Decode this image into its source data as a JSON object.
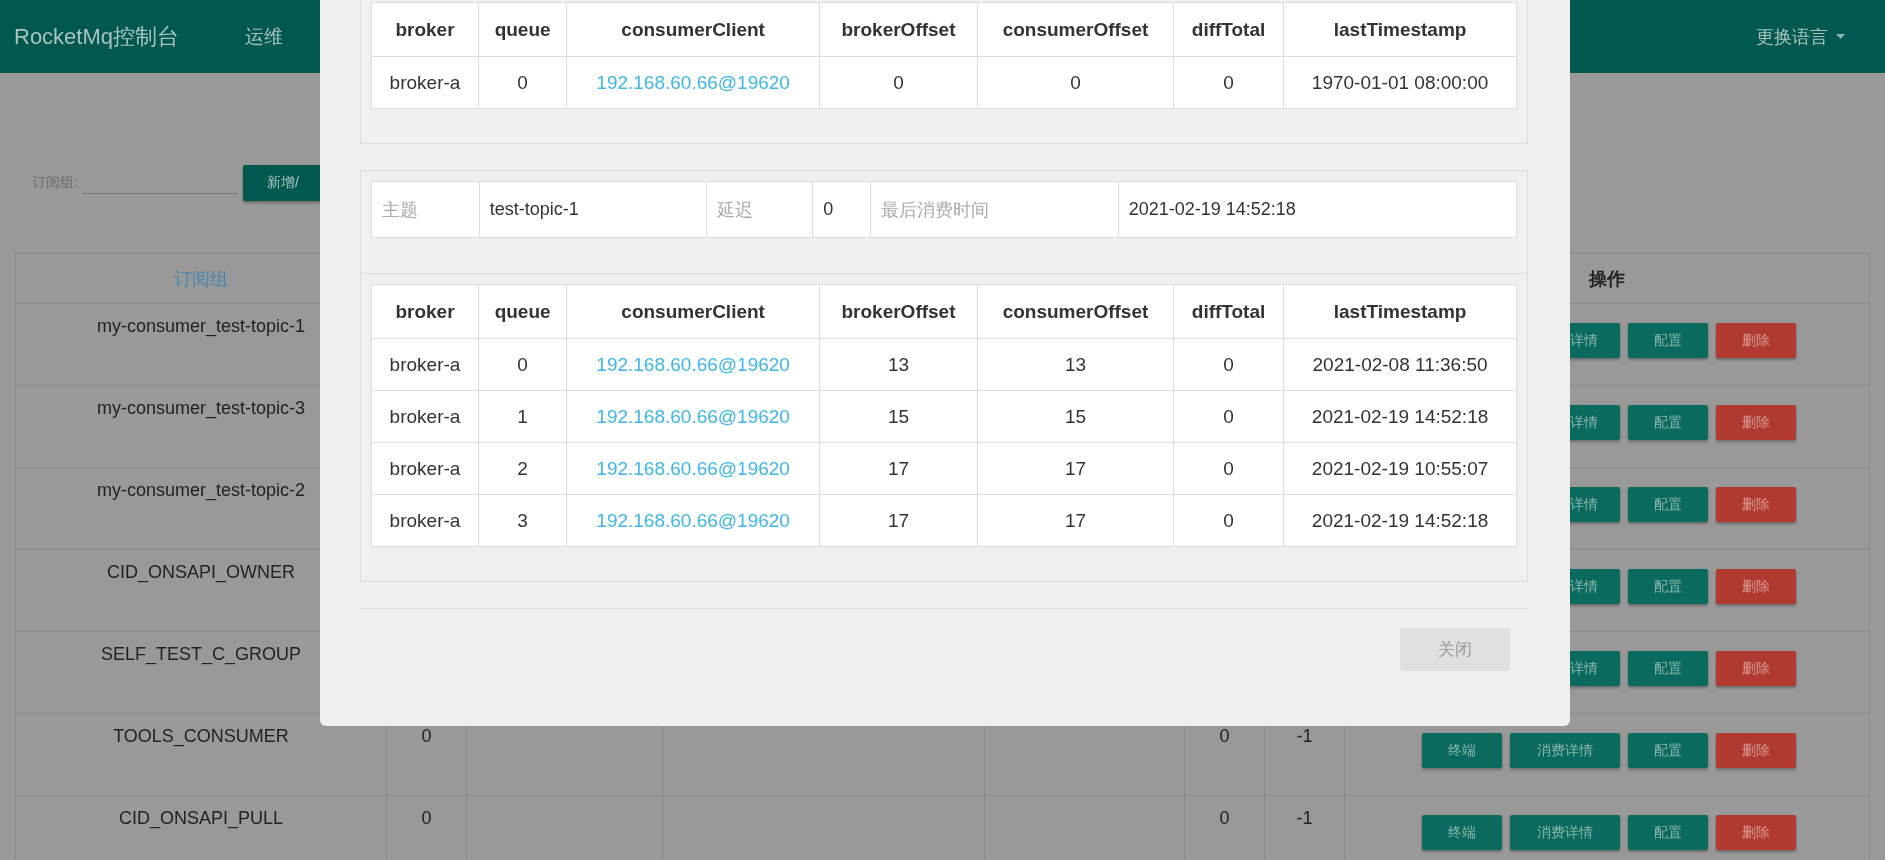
{
  "header": {
    "brand": "RocketMq控制台",
    "nav": [
      {
        "label": "运维"
      }
    ],
    "language": "更换语言"
  },
  "filter": {
    "label": "订阅组:",
    "button": "新增/"
  },
  "table": {
    "columns": [
      {
        "label": "订阅组",
        "kind": "link"
      },
      {
        "label": "操作",
        "kind": "bold"
      }
    ],
    "rows": [
      {
        "group": "my-consumer_test-topic-1",
        "actions": [
          {
            "kind": "partial",
            "label": "详情"
          },
          {
            "kind": "primary",
            "label": "配置"
          },
          {
            "kind": "danger",
            "label": "删除"
          }
        ]
      },
      {
        "group": "my-consumer_test-topic-3",
        "actions": [
          {
            "kind": "partial",
            "label": "详情"
          },
          {
            "kind": "primary",
            "label": "配置"
          },
          {
            "kind": "danger",
            "label": "删除"
          }
        ]
      },
      {
        "group": "my-consumer_test-topic-2",
        "actions": [
          {
            "kind": "partial",
            "label": "详情"
          },
          {
            "kind": "primary",
            "label": "配置"
          },
          {
            "kind": "danger",
            "label": "删除"
          }
        ]
      },
      {
        "group": "CID_ONSAPI_OWNER",
        "actions": [
          {
            "kind": "partial",
            "label": "详情"
          },
          {
            "kind": "primary",
            "label": "配置"
          },
          {
            "kind": "danger",
            "label": "删除"
          }
        ]
      },
      {
        "group": "SELF_TEST_C_GROUP",
        "actions": [
          {
            "kind": "partial",
            "label": "详情"
          },
          {
            "kind": "primary",
            "label": "配置"
          },
          {
            "kind": "danger",
            "label": "删除"
          }
        ]
      },
      {
        "group": "TOOLS_CONSUMER",
        "column_2": "0",
        "column_6": "0",
        "column_7": "-1",
        "actions": [
          {
            "kind": "primary",
            "label": "终端"
          },
          {
            "kind": "primary",
            "label": "消费详情"
          },
          {
            "kind": "primary",
            "label": "配置"
          },
          {
            "kind": "danger",
            "label": "删除"
          }
        ]
      },
      {
        "group": "CID_ONSAPI_PULL",
        "column_2": "0",
        "column_6": "0",
        "column_7": "-1",
        "actions": [
          {
            "kind": "primary",
            "label": "终端"
          },
          {
            "kind": "primary",
            "label": "消费详情"
          },
          {
            "kind": "primary",
            "label": "配置"
          },
          {
            "kind": "danger",
            "label": "删除"
          }
        ]
      }
    ]
  },
  "dialog": {
    "sections": [
      {
        "columns": [
          {
            "label": "broker",
            "kind": "text"
          },
          {
            "label": "queue",
            "kind": "text"
          },
          {
            "label": "consumerClient",
            "kind": "link"
          },
          {
            "label": "brokerOffset",
            "kind": "text"
          },
          {
            "label": "consumerOffset",
            "kind": "text"
          },
          {
            "label": "diffTotal",
            "kind": "text"
          },
          {
            "label": "lastTimestamp",
            "kind": "text"
          }
        ],
        "rows": [
          [
            "broker-a",
            "0",
            "192.168.60.66@19620",
            "0",
            "0",
            "0",
            "1970-01-01 08:00:00"
          ]
        ]
      },
      {
        "info": [
          {
            "label": "主题",
            "value": "test-topic-1"
          },
          {
            "label": "延迟",
            "value": "0"
          },
          {
            "label": "最后消费时间",
            "value": "2021-02-19 14:52:18"
          }
        ],
        "columns": [
          {
            "label": "broker",
            "kind": "text"
          },
          {
            "label": "queue",
            "kind": "text"
          },
          {
            "label": "consumerClient",
            "kind": "link"
          },
          {
            "label": "brokerOffset",
            "kind": "text"
          },
          {
            "label": "consumerOffset",
            "kind": "text"
          },
          {
            "label": "diffTotal",
            "kind": "text"
          },
          {
            "label": "lastTimestamp",
            "kind": "text"
          }
        ],
        "rows": [
          [
            "broker-a",
            "0",
            "192.168.60.66@19620",
            "13",
            "13",
            "0",
            "2021-02-08 11:36:50"
          ],
          [
            "broker-a",
            "1",
            "192.168.60.66@19620",
            "15",
            "15",
            "0",
            "2021-02-19 14:52:18"
          ],
          [
            "broker-a",
            "2",
            "192.168.60.66@19620",
            "17",
            "17",
            "0",
            "2021-02-19 10:55:07"
          ],
          [
            "broker-a",
            "3",
            "192.168.60.66@19620",
            "17",
            "17",
            "0",
            "2021-02-19 14:52:18"
          ]
        ]
      }
    ],
    "close": "关闭"
  }
}
